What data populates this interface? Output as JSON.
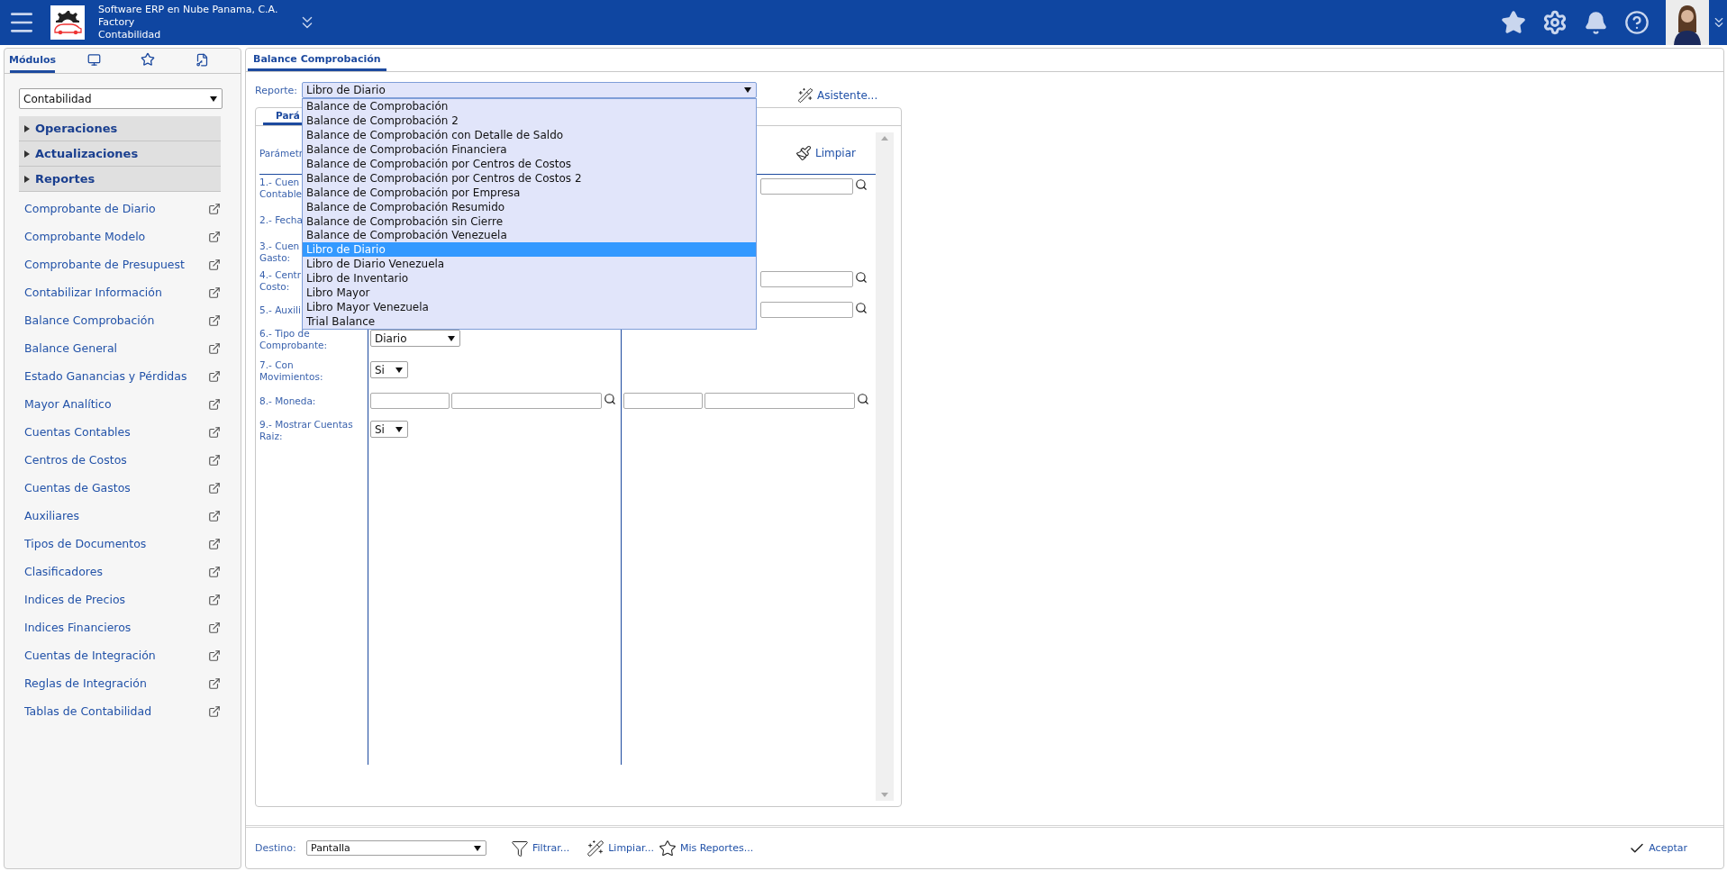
{
  "header": {
    "company": "Software ERP en Nube Panama, C.A.",
    "site": "Factory",
    "module": "Contabilidad"
  },
  "sidebar": {
    "tabs": [
      {
        "kind": "text",
        "label": "Módulos",
        "selected": true
      },
      {
        "kind": "monitor",
        "selected": false
      },
      {
        "kind": "star",
        "selected": false
      },
      {
        "kind": "document",
        "selected": false
      }
    ],
    "module_select": "Contabilidad",
    "sections": [
      {
        "label": "Operaciones",
        "expanded": false
      },
      {
        "label": "Actualizaciones",
        "expanded": false
      },
      {
        "label": "Reportes",
        "expanded": false
      }
    ],
    "items": [
      "Comprobante de Diario",
      "Comprobante Modelo",
      "Comprobante de Presupuest",
      "Contabilizar Información",
      "Balance Comprobación",
      "Balance General",
      "Estado Ganancias y Pérdidas",
      "Mayor Analítico",
      "Cuentas Contables",
      "Centros de Costos",
      "Cuentas de Gastos",
      "Auxiliares",
      "Tipos de Documentos",
      "Clasificadores",
      "Indices de Precios",
      "Indices Financieros",
      "Cuentas de Integración",
      "Reglas de Integración",
      "Tablas de Contabilidad"
    ]
  },
  "main": {
    "tabs": [
      {
        "label": "Balance Comprobación",
        "selected": true
      }
    ],
    "report_label": "Reporte:",
    "report_select": {
      "value": "Libro de Diario",
      "expanded": true,
      "options": [
        {
          "label": "Balance de Comprobación",
          "selected": false
        },
        {
          "label": "Balance de Comprobación 2",
          "selected": false
        },
        {
          "label": "Balance de Comprobación con Detalle de Saldo",
          "selected": false
        },
        {
          "label": "Balance de Comprobación Financiera",
          "selected": false
        },
        {
          "label": "Balance de Comprobación por Centros de Costos",
          "selected": false
        },
        {
          "label": "Balance de Comprobación por Centros de Costos 2",
          "selected": false
        },
        {
          "label": "Balance de Comprobación por Empresa",
          "selected": false
        },
        {
          "label": "Balance de Comprobación Resumido",
          "selected": false
        },
        {
          "label": "Balance de Comprobación sin Cierre",
          "selected": false
        },
        {
          "label": "Balance de Comprobación Venezuela",
          "selected": false
        },
        {
          "label": "Libro de Diario",
          "selected": true
        },
        {
          "label": "Libro de Diario Venezuela",
          "selected": false
        },
        {
          "label": "Libro de Inventario",
          "selected": false
        },
        {
          "label": "Libro Mayor",
          "selected": false
        },
        {
          "label": "Libro Mayor Venezuela",
          "selected": false
        },
        {
          "label": "Trial Balance",
          "selected": false
        }
      ]
    },
    "assistant": "Asistente...",
    "inner_tabs": [
      {
        "label": "Pará",
        "selected": true
      }
    ],
    "params_heading": "Parámetr",
    "clear": "Limpiar",
    "params": [
      {
        "label": [
          "1.- Cuen",
          "Contable"
        ],
        "kind": "partial"
      },
      {
        "label": [
          "2.- Fecha"
        ],
        "kind": "empty"
      },
      {
        "label": [
          "3.- Cuen",
          "Gasto:"
        ],
        "kind": "empty"
      },
      {
        "label": [
          "4.- Centr",
          "Costo:"
        ],
        "kind": "partial"
      },
      {
        "label": [
          "5.- Auxili"
        ],
        "kind": "partial"
      },
      {
        "label": [
          "6.- Tipo de",
          "Comprobante:"
        ],
        "kind": "select",
        "value": "Diario"
      },
      {
        "label": [
          "7.- Con",
          "Movimientos:"
        ],
        "kind": "toggle",
        "value": "Si"
      },
      {
        "label": [
          "8.- Moneda:"
        ],
        "kind": "range"
      },
      {
        "label": [
          "9.- Mostrar Cuentas",
          "Raiz:"
        ],
        "kind": "toggle",
        "value": "Si"
      }
    ]
  },
  "bottom_bar": {
    "destination_label": "Destino:",
    "destination": "Pantalla",
    "actions": [
      {
        "kind": "filter",
        "label": "Filtrar..."
      },
      {
        "kind": "wizard",
        "label": "Limpiar..."
      },
      {
        "kind": "star",
        "label": "Mis Reportes..."
      }
    ],
    "accept": "Aceptar"
  }
}
